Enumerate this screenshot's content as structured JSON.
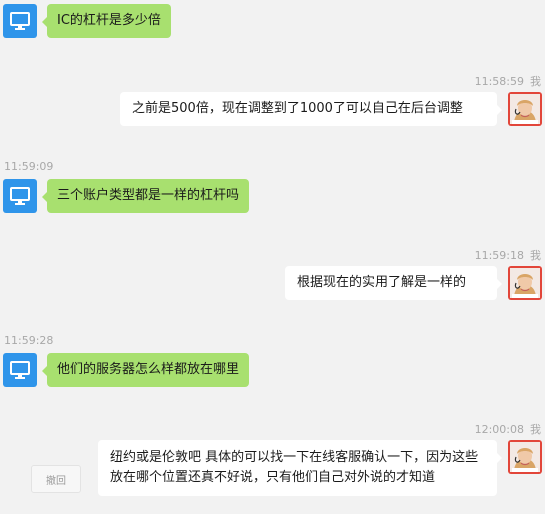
{
  "icons": {
    "contact_avatar": "monitor-icon",
    "user_avatar": "person-photo"
  },
  "colors": {
    "contact_avatar_bg": "#2f95ea",
    "contact_bubble": "#a8e06f",
    "user_bubble": "#ffffff",
    "timestamp_text": "#a8a8a8",
    "user_avatar_border": "#e2463a"
  },
  "messages": [
    {
      "side": "left",
      "text": "IC的杠杆是多少倍"
    },
    {
      "side": "right",
      "time": "11:58:59",
      "sender": "我",
      "text": "之前是500倍，现在调整到了1000了可以自己在后台调整"
    },
    {
      "side": "left",
      "time": "11:59:09",
      "text": "三个账户类型都是一样的杠杆吗"
    },
    {
      "side": "right",
      "time": "11:59:18",
      "sender": "我",
      "text": "根据现在的实用了解是一样的"
    },
    {
      "side": "left",
      "time": "11:59:28",
      "text": "他们的服务器怎么样都放在哪里"
    },
    {
      "side": "right",
      "time": "12:00:08",
      "sender": "我",
      "text": "纽约或是伦敦吧 具体的可以找一下在线客服确认一下，因为这些放在哪个位置还真不好说，只有他们自己对外说的才知道"
    }
  ],
  "recall_label": "撤回"
}
